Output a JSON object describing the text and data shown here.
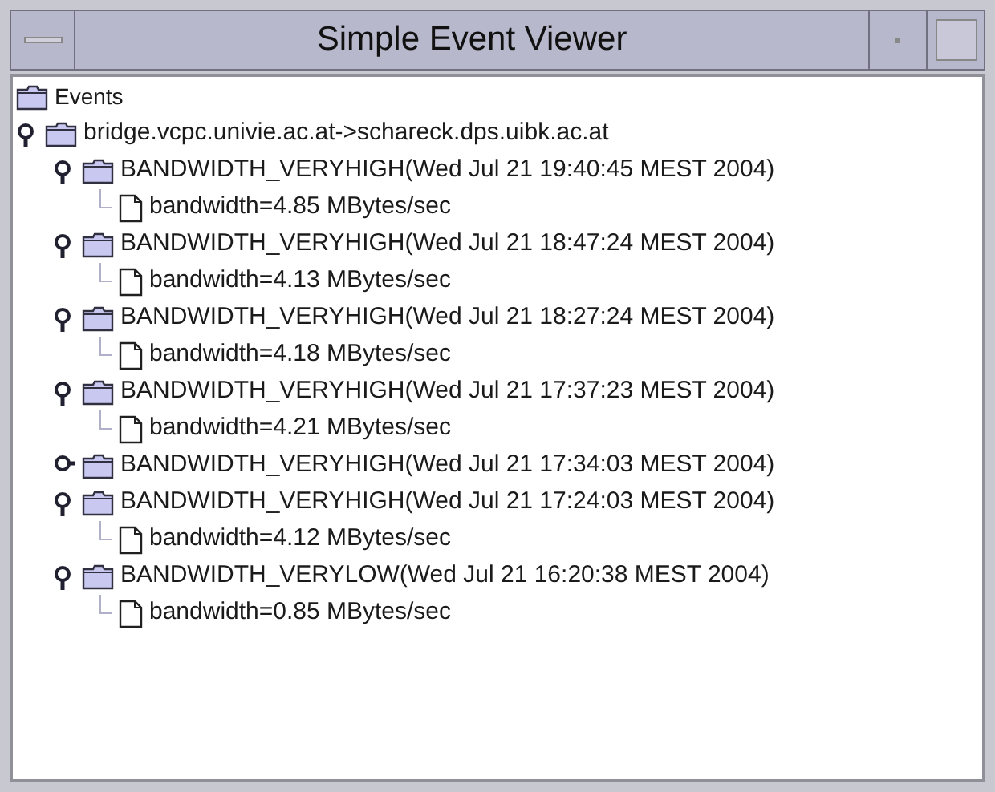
{
  "window": {
    "title": "Simple Event Viewer"
  },
  "tree": {
    "label": "Events",
    "children": [
      {
        "label": "bridge.vcpc.univie.ac.at->schareck.dps.uibk.ac.at",
        "expanded": true,
        "children": [
          {
            "label": "BANDWIDTH_VERYHIGH(Wed Jul 21 19:40:45 MEST 2004)",
            "expanded": true,
            "children": [
              {
                "label": "bandwidth=4.85 MBytes/sec"
              }
            ]
          },
          {
            "label": "BANDWIDTH_VERYHIGH(Wed Jul 21 18:47:24 MEST 2004)",
            "expanded": true,
            "children": [
              {
                "label": "bandwidth=4.13 MBytes/sec"
              }
            ]
          },
          {
            "label": "BANDWIDTH_VERYHIGH(Wed Jul 21 18:27:24 MEST 2004)",
            "expanded": true,
            "children": [
              {
                "label": "bandwidth=4.18 MBytes/sec"
              }
            ]
          },
          {
            "label": "BANDWIDTH_VERYHIGH(Wed Jul 21 17:37:23 MEST 2004)",
            "expanded": true,
            "children": [
              {
                "label": "bandwidth=4.21 MBytes/sec"
              }
            ]
          },
          {
            "label": "BANDWIDTH_VERYHIGH(Wed Jul 21 17:34:03 MEST 2004)",
            "expanded": false
          },
          {
            "label": "BANDWIDTH_VERYHIGH(Wed Jul 21 17:24:03 MEST 2004)",
            "expanded": true,
            "children": [
              {
                "label": "bandwidth=4.12 MBytes/sec"
              }
            ]
          },
          {
            "label": "BANDWIDTH_VERYLOW(Wed Jul 21 16:20:38 MEST 2004)",
            "expanded": true,
            "children": [
              {
                "label": "bandwidth=0.85 MBytes/sec"
              }
            ]
          }
        ]
      }
    ]
  }
}
